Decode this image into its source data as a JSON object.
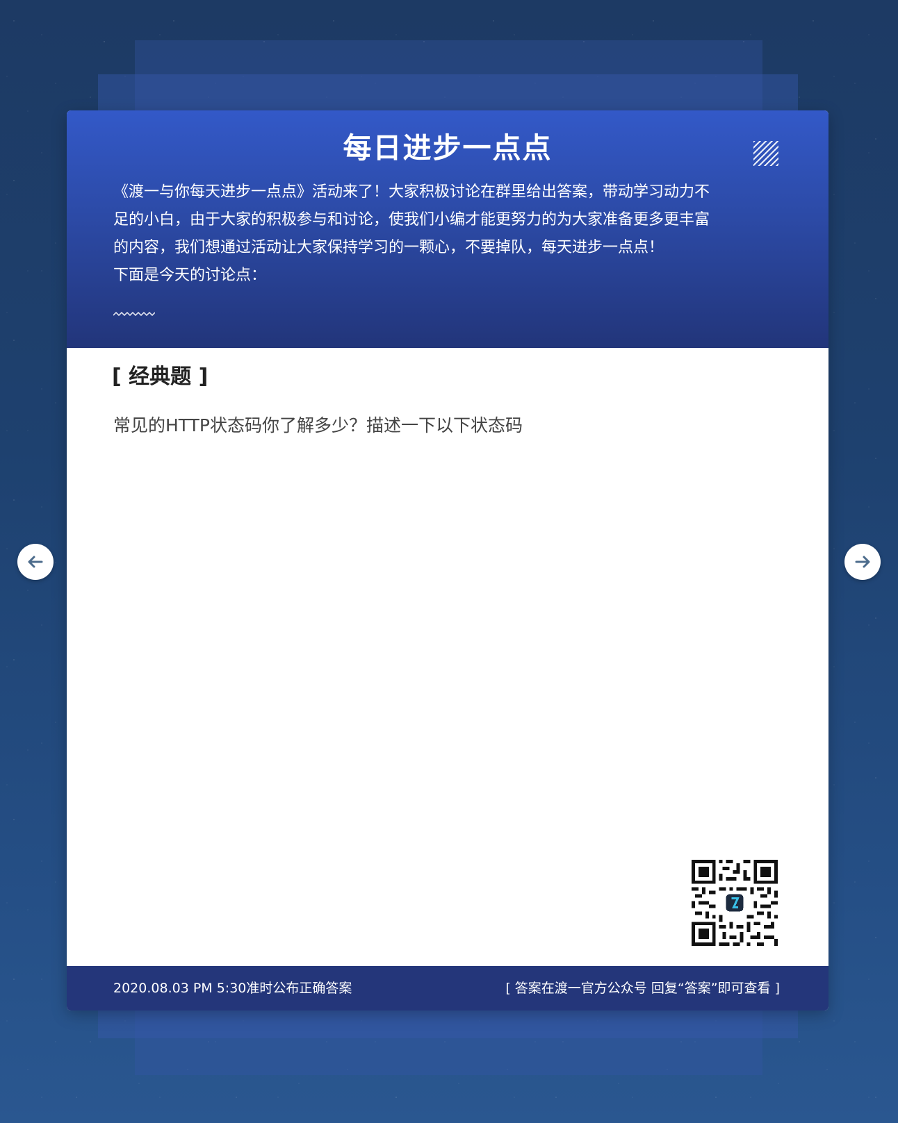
{
  "header": {
    "title": "每日进步一点点",
    "intro_lines": [
      "《渡一与你每天进步一点点》活动来了！大家积极讨论在群里给出答案，带动学习动力不",
      "足的小白，由于大家的积极参与和讨论，使我们小编才能更努力的为大家准备更多更丰富",
      "的内容，我们想通过活动让大家保持学习的一颗心，不要掉队，每天进步一点点！",
      "下面是今天的讨论点："
    ]
  },
  "body": {
    "section_title": "[ 经典题 ]",
    "question": "常见的HTTP状态码你了解多少？描述一下以下状态码"
  },
  "footer": {
    "publish_time": "2020.08.03  PM  5:30准时公布正确答案",
    "answer_hint": "[   答案在渡一官方公众号 回复“答案”即可查看   ]"
  },
  "icons": {
    "prev": "arrow-left-icon",
    "next": "arrow-right-icon",
    "decor": "diagonal-stripes-icon",
    "wave": "wave-divider-icon",
    "qr": "qr-code"
  },
  "colors": {
    "background": "#1e416f",
    "header_top": "#3359c8",
    "header_bottom": "#22357a",
    "footer": "#24367a",
    "nav_arrow": "#4d6c8c"
  }
}
